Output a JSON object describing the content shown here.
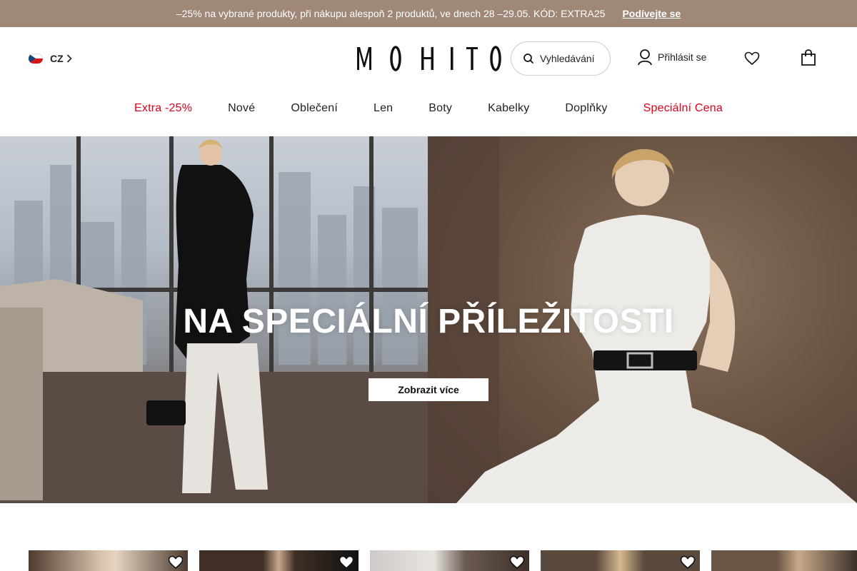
{
  "promo": {
    "text": "–25% na vybrané produkty, při nákupu alespoň 2 produktů, ve dnech 28 –29.05. KÓD: EXTRA25",
    "link": "Podívejte se",
    "bg_color": "#9f8877"
  },
  "header": {
    "country_code": "CZ",
    "flag_icon": "czech-flag-icon",
    "logo_text": "MOHITO",
    "search_label": "Vyhledávání",
    "login_label": "Přihlásit se",
    "wishlist_icon": "heart-icon",
    "bag_icon": "shopping-bag-icon"
  },
  "nav": {
    "items": [
      {
        "label": "Extra -25%",
        "highlight": true
      },
      {
        "label": "Nové",
        "highlight": false
      },
      {
        "label": "Oblečení",
        "highlight": false
      },
      {
        "label": "Len",
        "highlight": false
      },
      {
        "label": "Boty",
        "highlight": false
      },
      {
        "label": "Kabelky",
        "highlight": false
      },
      {
        "label": "Doplňky",
        "highlight": false
      },
      {
        "label": "Speciální Cena",
        "highlight": true
      }
    ],
    "highlight_color": "#e1001b"
  },
  "hero": {
    "title": "NA SPECIÁLNÍ PŘÍLEŽITOSTI",
    "button_label": "Zobrazit více"
  },
  "colors": {
    "accent": "#e1001b",
    "text": "#222222"
  }
}
